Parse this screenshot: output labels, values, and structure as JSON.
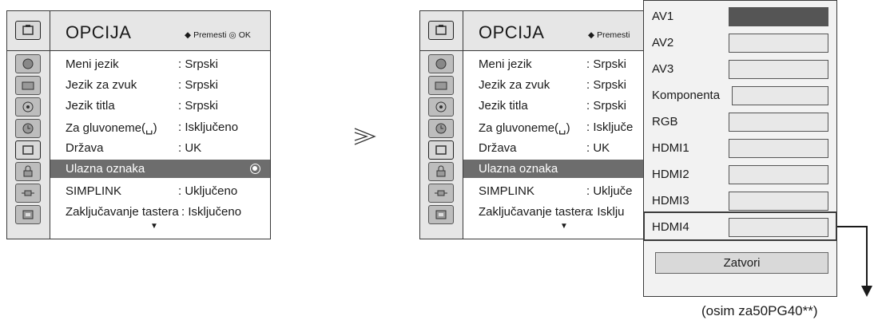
{
  "menu": {
    "title": "OPCIJA",
    "hint_move": "Premesti",
    "hint_ok": "OK",
    "categories": [
      "picture-icon",
      "audio-icon",
      "clock-icon",
      "timer-icon",
      "option-icon",
      "lock-icon",
      "input-icon",
      "usb-icon"
    ],
    "active_category": 4,
    "rows": [
      {
        "label": "Meni jezik",
        "value": ": Srpski"
      },
      {
        "label": "Jezik za zvuk",
        "value": ": Srpski"
      },
      {
        "label": "Jezik titla",
        "value": ": Srpski"
      },
      {
        "label": "Za gluvoneme(␣)",
        "value": ": Isključeno"
      },
      {
        "label": "Država",
        "value": ": UK"
      },
      {
        "label": "Ulazna oznaka",
        "value": ""
      },
      {
        "label": "SIMPLINK",
        "value": ": Uključeno"
      },
      {
        "label": "Zaključavanje tastera",
        "value": ": Isključeno"
      }
    ],
    "selected_row": 5,
    "scroll_down": "▼"
  },
  "menu2": {
    "title": "OPCIJA",
    "hint_move": "Premesti",
    "rows": [
      {
        "label": "Meni jezik",
        "value": ": Srpski"
      },
      {
        "label": "Jezik za zvuk",
        "value": ": Srpski"
      },
      {
        "label": "Jezik titla",
        "value": ": Srpski"
      },
      {
        "label": "Za gluvoneme(␣)",
        "value": ": Isključe"
      },
      {
        "label": "Država",
        "value": ": UK"
      },
      {
        "label": "Ulazna oznaka",
        "value": ""
      },
      {
        "label": "SIMPLINK",
        "value": ": Uključe"
      },
      {
        "label": "Zaključavanje tastera",
        "value": ": Isklju"
      }
    ]
  },
  "transition_arrow": "⋗",
  "popup": {
    "inputs": [
      "AV1",
      "AV2",
      "AV3",
      "Komponenta",
      "RGB",
      "HDMI1",
      "HDMI2",
      "HDMI3",
      "HDMI4"
    ],
    "active_input": 0,
    "close_label": "Zatvori"
  },
  "footnote": "(osim za50PG40**)",
  "colors": {
    "selected_row": "#6d6d6d",
    "header": "#e6e6e6",
    "border": "#3a3a3a"
  }
}
